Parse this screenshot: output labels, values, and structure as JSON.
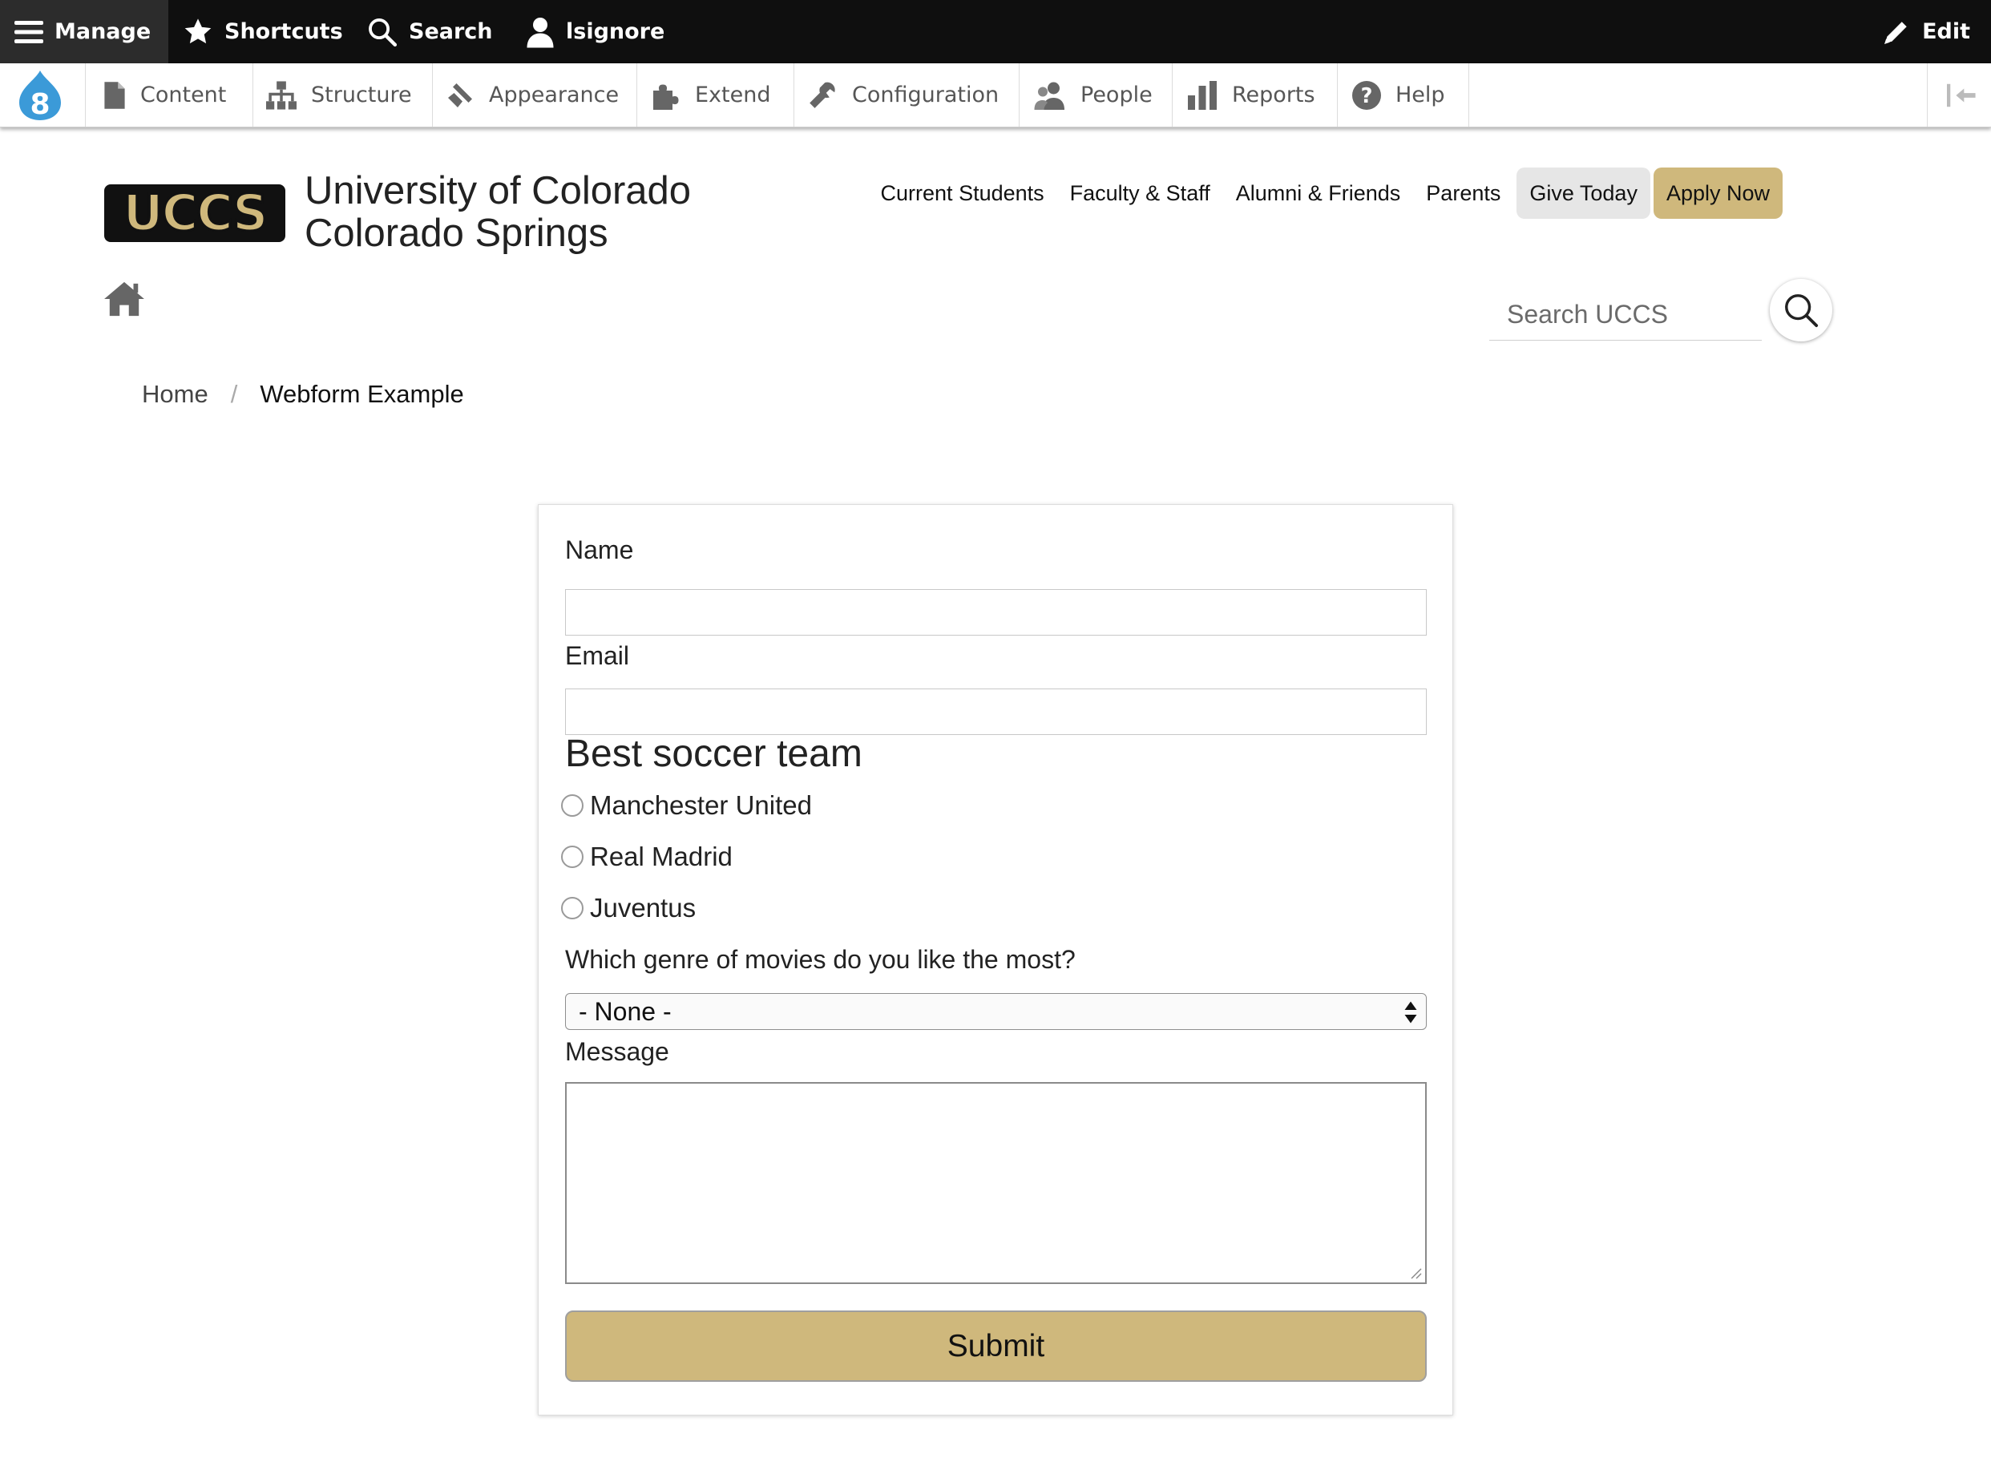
{
  "admin_toolbar": {
    "manage": "Manage",
    "shortcuts": "Shortcuts",
    "search": "Search",
    "user": "lsignore",
    "edit": "Edit"
  },
  "admin_tray": {
    "items": [
      {
        "label": "Content",
        "icon": "document-icon"
      },
      {
        "label": "Structure",
        "icon": "hierarchy-icon"
      },
      {
        "label": "Appearance",
        "icon": "paintbrush-icon"
      },
      {
        "label": "Extend",
        "icon": "puzzle-icon"
      },
      {
        "label": "Configuration",
        "icon": "wrench-icon"
      },
      {
        "label": "People",
        "icon": "people-icon"
      },
      {
        "label": "Reports",
        "icon": "bar-chart-icon"
      },
      {
        "label": "Help",
        "icon": "question-icon"
      }
    ]
  },
  "site": {
    "logo_text": "UCCS",
    "name_line1": "University of Colorado",
    "name_line2": "Colorado Springs",
    "nav": [
      "Current Students",
      "Faculty & Staff",
      "Alumni & Friends",
      "Parents"
    ],
    "give_label": "Give Today",
    "apply_label": "Apply Now",
    "search_placeholder": "Search UCCS"
  },
  "breadcrumb": {
    "home": "Home",
    "separator": "/",
    "current": "Webform Example"
  },
  "form": {
    "name_label": "Name",
    "email_label": "Email",
    "soccer_label": "Best soccer team",
    "soccer_options": [
      "Manchester United",
      "Real Madrid",
      "Juventus"
    ],
    "genre_label": "Which genre of movies do you like the most?",
    "genre_selected": "- None -",
    "message_label": "Message",
    "submit_label": "Submit"
  },
  "colors": {
    "admin_bar": "#0f0f0f",
    "gold": "#cfb87c",
    "drupal_blue": "#3b9ad8"
  }
}
